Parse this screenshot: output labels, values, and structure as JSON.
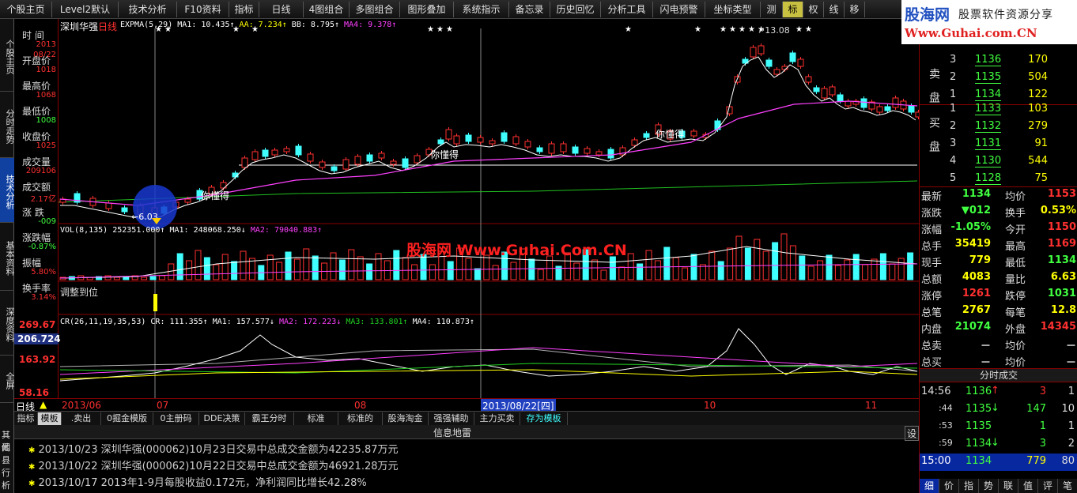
{
  "toolbar": {
    "items": [
      "个股主页",
      "Level2默认",
      "技术分析",
      "F10资料",
      "指标",
      "日线",
      "4图组合",
      "多图组合",
      "图形叠加",
      "系统指示",
      "备忘录",
      "历史回忆",
      "分析工具",
      "闪电预警",
      "坐标类型",
      "测",
      "标",
      "权",
      "线",
      "移"
    ],
    "active_index": 16
  },
  "brand": {
    "name": "股海网",
    "slogan": "股票软件资源分享",
    "url": "Www.Guhai.com.CN"
  },
  "sidebar": {
    "tabs": [
      "个股主页",
      "分时走势",
      "技术分析",
      "基本资料",
      "深度资料",
      "全屏"
    ],
    "active_index": 2
  },
  "infopanel": {
    "rows": [
      {
        "label": "时 间",
        "value": "2013",
        "value2": "08/22"
      },
      {
        "label": "开盘价",
        "value": "1018"
      },
      {
        "label": "最高价",
        "value": "1068"
      },
      {
        "label": "最低价",
        "value": "1008"
      },
      {
        "label": "收盘价",
        "value": "1025"
      },
      {
        "label": "成交量",
        "value": "209106"
      },
      {
        "label": "成交额",
        "value": "2.17亿"
      },
      {
        "label": "涨 跌",
        "value": "-009"
      },
      {
        "label": "涨跌幅",
        "value": "-0.87%"
      },
      {
        "label": "振幅",
        "value": "5.80%"
      },
      {
        "label": "换手率",
        "value": "3.14%"
      }
    ]
  },
  "chart": {
    "main_title": "深圳华强",
    "period": "日线",
    "expma_line": "EXPMA(5,29)  MA1: 10.435↑  AA: 7.234↑  BB: 8.795↑  MA4: 9.378↑",
    "expma_parts": {
      "ma1": "MA1: 10.435↑",
      "aa": "AA: 7.234↑",
      "bb": "BB: 8.795↑",
      "ma4": "MA4: 9.378↑",
      "head": "EXPMA(5,29)"
    },
    "high_label": "13.08",
    "low_label": "6.03",
    "annotation_text": "你懂得",
    "vol_line": {
      "head": "VOL(8,135)  252351.000↑",
      "ma1": "MA1: 248068.250↓",
      "ma2": "MA2: 79040.883↑"
    },
    "watermark": "股海网 Www.Guhai.Com.CN",
    "adjust_label": "调整到位",
    "cr_line": {
      "head": "CR(26,11,19,35,53)",
      "cr": "CR: 111.355↑",
      "ma1": "MA1: 157.577↓",
      "ma2": "MA2: 172.223↓",
      "ma3": "MA3: 133.801↑",
      "ma4": "MA4: 110.873↑"
    },
    "cr_axis": [
      "269.67",
      "206.724",
      "163.92",
      "58.16"
    ],
    "x_labels": [
      "2013/06",
      "07",
      "08",
      "2013/08/22[四]",
      "10",
      "11"
    ],
    "period_label": "日线"
  },
  "orderbook": {
    "sell_label": "卖盘",
    "buy_label": "买盘",
    "sells": [
      {
        "n": "3",
        "price": "1136",
        "vol": "170"
      },
      {
        "n": "2",
        "price": "1135",
        "vol": "504"
      },
      {
        "n": "1",
        "price": "1134",
        "vol": "122"
      }
    ],
    "buys": [
      {
        "n": "1",
        "price": "1133",
        "vol": "103"
      },
      {
        "n": "2",
        "price": "1132",
        "vol": "279"
      },
      {
        "n": "3",
        "price": "1131",
        "vol": "91"
      },
      {
        "n": "4",
        "price": "1130",
        "vol": "544"
      },
      {
        "n": "5",
        "price": "1128",
        "vol": "75"
      }
    ]
  },
  "quotes": [
    {
      "l1": "最新",
      "v1": "1134",
      "l2": "均价",
      "v2": "1153"
    },
    {
      "l1": "涨跌",
      "v1": "▼012",
      "l2": "换手",
      "v2": "0.53%"
    },
    {
      "l1": "涨幅",
      "v1": "-1.05%",
      "l2": "今开",
      "v2": "1150"
    },
    {
      "l1": "总手",
      "v1": "35419",
      "l2": "最高",
      "v2": "1169"
    },
    {
      "l1": "现手",
      "v1": "779",
      "l2": "最低",
      "v2": "1134"
    },
    {
      "l1": "总额",
      "v1": "4083",
      "l2": "量比",
      "v2": "6.63"
    },
    {
      "l1": "涨停",
      "v1": "1261",
      "l2": "跌停",
      "v2": "1031"
    },
    {
      "l1": "总笔",
      "v1": "2767",
      "l2": "每笔",
      "v2": "12.8"
    },
    {
      "l1": "内盘",
      "v1": "21074",
      "l2": "外盘",
      "v2": "14345"
    },
    {
      "l1": "总卖",
      "v1": "－",
      "l2": "均价",
      "v2": "－"
    },
    {
      "l1": "总买",
      "v1": "－",
      "l2": "均价",
      "v2": "－"
    }
  ],
  "ticks": {
    "title": "分时成交",
    "rows": [
      {
        "time": "14:56",
        "price": "1136",
        "arrow": "↑",
        "vol": "3",
        "n": "1"
      },
      {
        "time": ":44",
        "price": "1135",
        "arrow": "↓",
        "vol": "147",
        "n": "10"
      },
      {
        "time": ":53",
        "price": "1135",
        "arrow": "",
        "vol": "1",
        "n": "1"
      },
      {
        "time": ":59",
        "price": "1134",
        "arrow": "↓",
        "vol": "3",
        "n": "2"
      },
      {
        "time": "15:00",
        "price": "1134",
        "arrow": "",
        "vol": "779",
        "n": "80"
      }
    ]
  },
  "right_bottom_tabs": [
    "细",
    "价",
    "指",
    "势",
    "联",
    "值",
    "评",
    "笔"
  ],
  "bottom_tabs": [
    "指标",
    "模板",
    ".卖出",
    "0掘金模版",
    "0主册码",
    "DDE决策",
    "霸王分时",
    "标准",
    "标准的",
    "股海淘金",
    "强强辅助",
    "主力买卖",
    "存为模板"
  ],
  "bottom_tabs_active": 1,
  "news": {
    "title": "信息地雷",
    "side": [
      "其他",
      "闻",
      "县",
      "行",
      "析"
    ],
    "settings": "设",
    "items": [
      {
        "date": "2013/10/23",
        "text": "深圳华强(000062)10月23日交易中总成交金额为42235.87万元"
      },
      {
        "date": "2013/10/22",
        "text": "深圳华强(000062)10月22日交易中总成交金额为46921.28万元"
      },
      {
        "date": "2013/10/17",
        "text": "2013年1-9月每股收益0.172元，净利润同比增长42.28%"
      }
    ]
  }
}
